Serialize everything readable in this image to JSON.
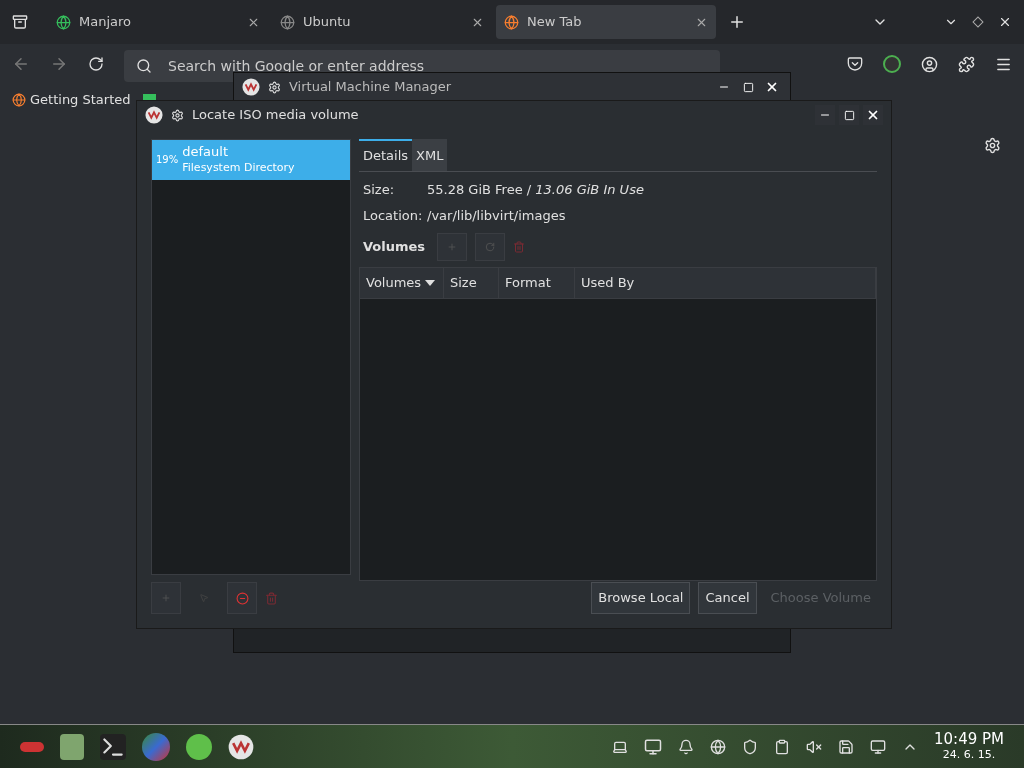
{
  "browser": {
    "tabs": [
      {
        "label": "Manjaro",
        "selected": false
      },
      {
        "label": "Ubuntu",
        "selected": false
      },
      {
        "label": "New Tab",
        "selected": true
      }
    ],
    "address": {
      "placeholder": "Search with Google or enter address"
    },
    "bookmarks": [
      "Getting Started"
    ]
  },
  "vmm_window": {
    "title": "Virtual Machine Manager"
  },
  "dialog": {
    "title": "Locate ISO media volume",
    "pools": [
      {
        "percent": "19%",
        "name": "default",
        "type": "Filesystem Directory",
        "selected": true
      }
    ],
    "tabs": [
      {
        "label": "Details",
        "selected": true
      },
      {
        "label": "XML",
        "selected": false
      }
    ],
    "details": [
      {
        "label": "Size:",
        "value": "55.28 GiB Free / *13.06 GiB In Use*"
      },
      {
        "label": "Location:",
        "value": "/var/lib/libvirt/images"
      }
    ],
    "volumes_label": "Volumes",
    "columns": [
      {
        "label": "Volumes",
        "sorted": true
      },
      {
        "label": "Size",
        "sorted": false
      },
      {
        "label": "Format",
        "sorted": false
      },
      {
        "label": "Used By",
        "sorted": false
      }
    ],
    "buttons": [
      {
        "label": "Browse Local",
        "disabled": false
      },
      {
        "label": "Cancel",
        "disabled": false
      },
      {
        "label": "Choose Volume",
        "disabled": true
      }
    ]
  },
  "taskbar": {
    "time": "10:49 PM",
    "date": "24. 6. 15."
  }
}
